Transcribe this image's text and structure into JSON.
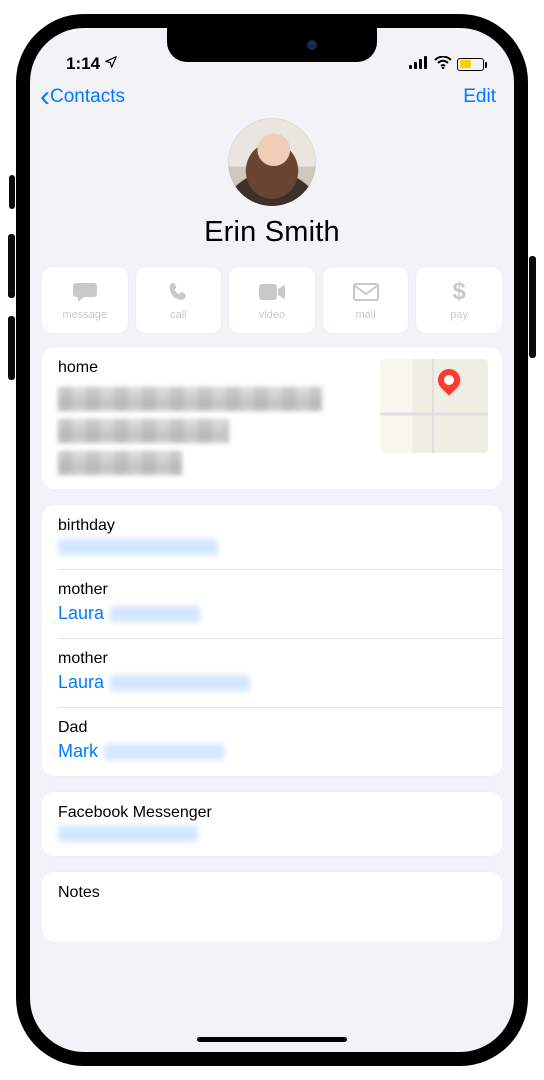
{
  "status": {
    "time": "1:14",
    "location_icon": "location-arrow",
    "battery_level_pct": 46,
    "low_power": true
  },
  "nav": {
    "back_label": "Contacts",
    "edit_label": "Edit"
  },
  "contact": {
    "name": "Erin Smith"
  },
  "actions": [
    {
      "icon": "message",
      "label": "message"
    },
    {
      "icon": "call",
      "label": "call"
    },
    {
      "icon": "video",
      "label": "video"
    },
    {
      "icon": "mail",
      "label": "mail"
    },
    {
      "icon": "pay",
      "label": "pay"
    }
  ],
  "address_section": {
    "label": "home",
    "value_redacted": true
  },
  "info_cells": [
    {
      "label": "birthday",
      "value_prefix": "",
      "value_redacted": true
    },
    {
      "label": "mother",
      "value_prefix": "Laura",
      "value_redacted": true
    },
    {
      "label": "mother",
      "value_prefix": "Laura",
      "value_redacted": true
    },
    {
      "label": "Dad",
      "value_prefix": "Mark",
      "value_redacted": true
    }
  ],
  "messenger_cell": {
    "label": "Facebook Messenger",
    "value_redacted": true
  },
  "notes_cell": {
    "label": "Notes"
  },
  "colors": {
    "accent": "#007aff",
    "battery": "#ffcc00",
    "pin": "#ff3b30"
  }
}
